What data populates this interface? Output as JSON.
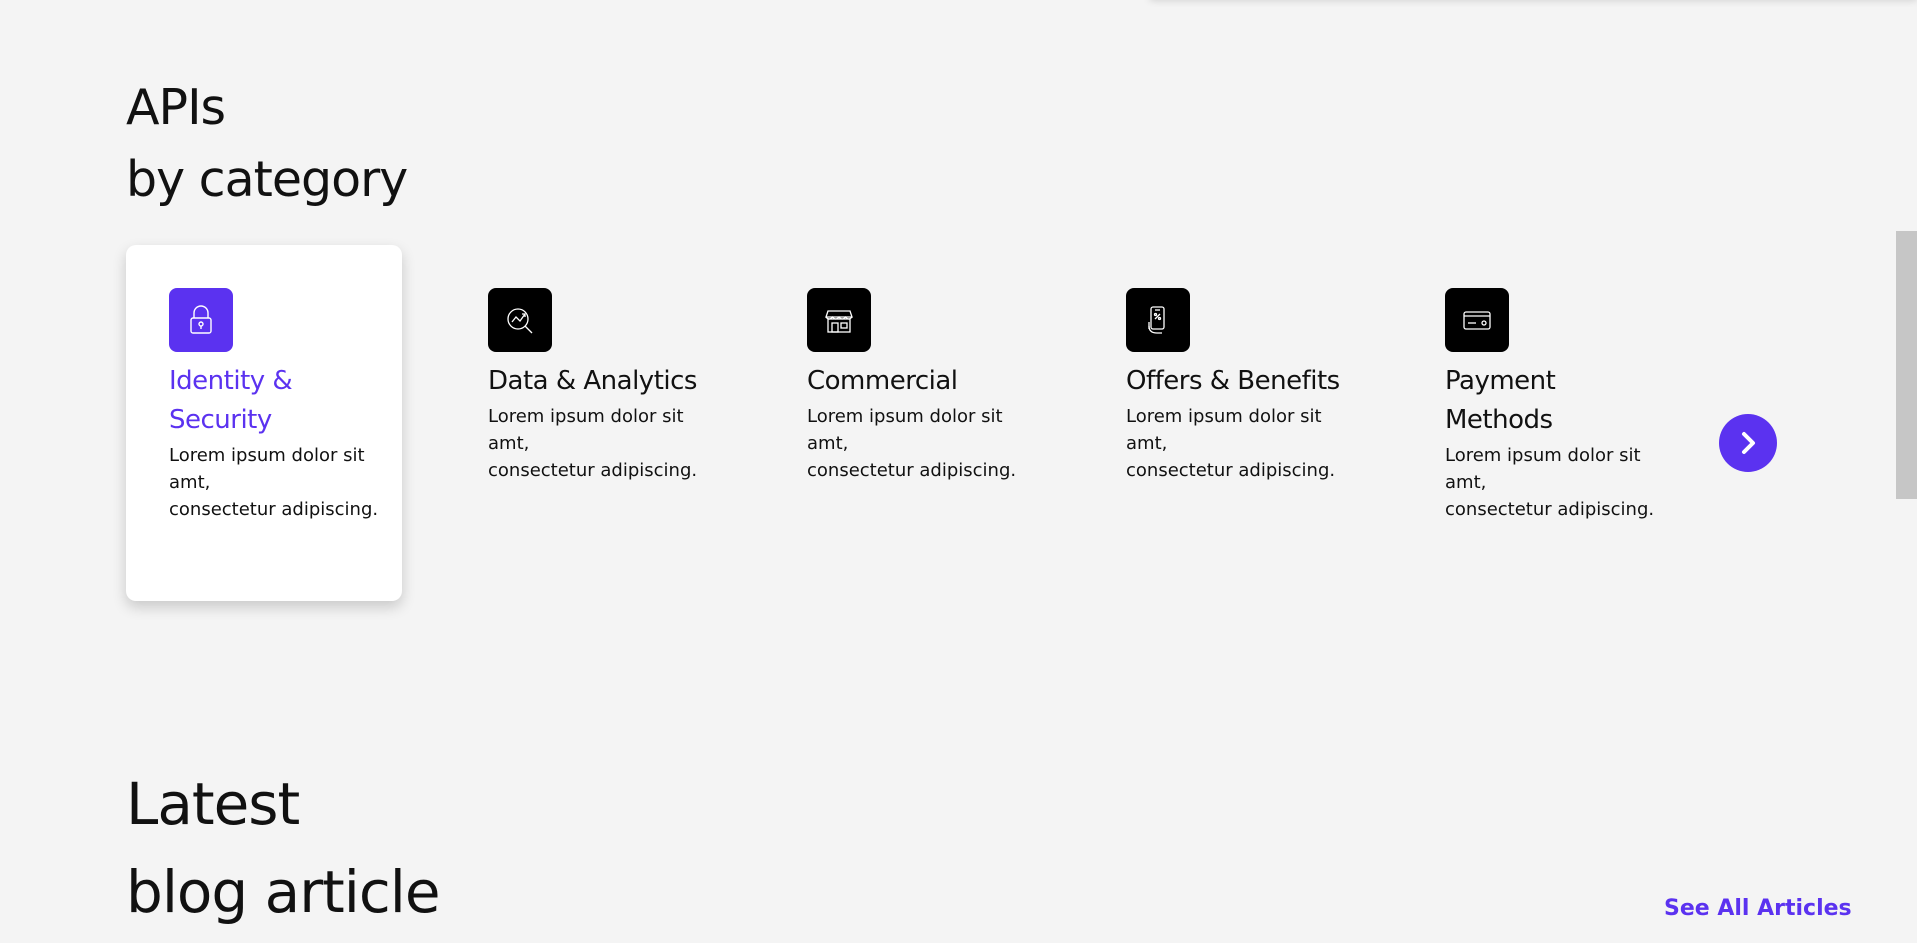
{
  "apis_section": {
    "title_line1": "APIs",
    "title_line2": "by category"
  },
  "categories": [
    {
      "title": "Identity & Security",
      "description": "Lorem ipsum dolor sit amt,\nconsectetur adipiscing.",
      "icon": "lock-icon",
      "active": true
    },
    {
      "title": "Data & Analytics",
      "description": "Lorem ipsum dolor sit amt,\nconsectetur adipiscing.",
      "icon": "analytics-magnifier-icon",
      "active": false
    },
    {
      "title": "Commercial",
      "description": "Lorem ipsum dolor sit amt,\nconsectetur adipiscing.",
      "icon": "storefront-icon",
      "active": false
    },
    {
      "title": "Offers & Benefits",
      "description": "Lorem ipsum dolor sit amt,\nconsectetur adipiscing.",
      "icon": "mobile-offer-icon",
      "active": false
    },
    {
      "title": "Payment Methods",
      "description": "Lorem ipsum dolor sit amt,\nconsectetur adipiscing.",
      "icon": "credit-card-icon",
      "active": false
    }
  ],
  "carousel": {
    "next_icon": "chevron-right-icon"
  },
  "blog_section": {
    "title_line1": "Latest",
    "title_line2": "blog article",
    "see_all_label": "See All Articles"
  },
  "colors": {
    "accent": "#5b32f0",
    "background": "#f4f4f4",
    "icon_tile": "#000000"
  }
}
